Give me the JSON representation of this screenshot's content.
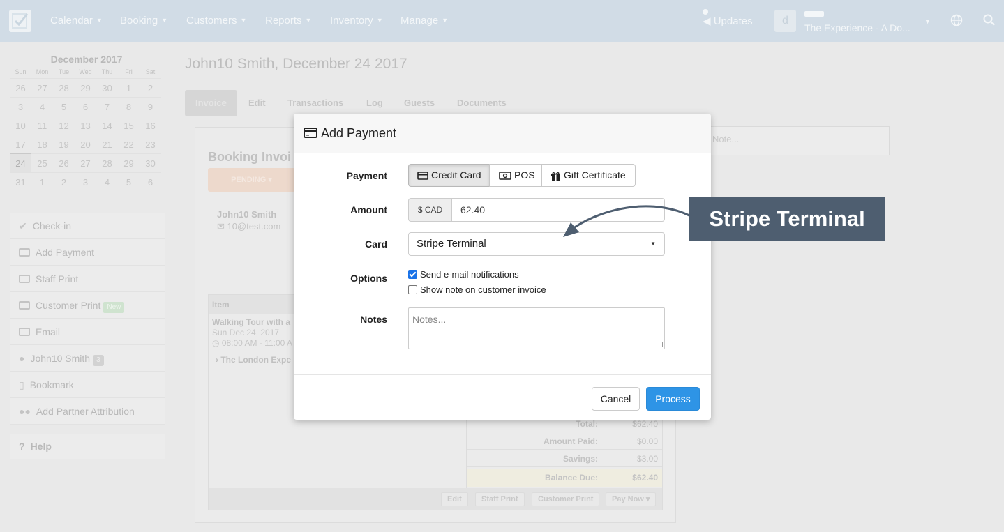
{
  "nav": {
    "items": [
      {
        "label": "Calendar"
      },
      {
        "label": "Booking"
      },
      {
        "label": "Customers"
      },
      {
        "label": "Reports"
      },
      {
        "label": "Inventory"
      },
      {
        "label": "Manage"
      }
    ],
    "updates_label": "Updates",
    "avatar_initial": "d",
    "account_name": "The Experience - A Do..."
  },
  "calendar": {
    "title": "December 2017",
    "dows": [
      "Sun",
      "Mon",
      "Tue",
      "Wed",
      "Thu",
      "Fri",
      "Sat"
    ],
    "days": [
      "26",
      "27",
      "28",
      "29",
      "30",
      "1",
      "2",
      "3",
      "4",
      "5",
      "6",
      "7",
      "8",
      "9",
      "10",
      "11",
      "12",
      "13",
      "14",
      "15",
      "16",
      "17",
      "18",
      "19",
      "20",
      "21",
      "22",
      "23",
      "24",
      "25",
      "26",
      "27",
      "28",
      "29",
      "30",
      "31",
      "1",
      "2",
      "3",
      "4",
      "5",
      "6"
    ],
    "selected": "24"
  },
  "sidebar": {
    "items": [
      {
        "label": "Check-in"
      },
      {
        "label": "Add Payment"
      },
      {
        "label": "Staff Print"
      },
      {
        "label": "Customer Print",
        "badge": "New"
      },
      {
        "label": "Email"
      },
      {
        "label": "John10 Smith",
        "badge": "3"
      },
      {
        "label": "Bookmark"
      },
      {
        "label": "Add Partner Attribution"
      }
    ],
    "help_label": "Help"
  },
  "page": {
    "title": "John10 Smith, December 24 2017",
    "tabs": [
      "Invoice",
      "Edit",
      "Transactions",
      "Log",
      "Guests",
      "Documents"
    ],
    "booking_title": "Booking Invoi",
    "status": "PENDING",
    "customer_name": "John10 Smith",
    "customer_email": "10@test.com",
    "note_placeholder": "Note...",
    "items_header": "Item",
    "item": {
      "name": "Walking Tour with a",
      "date": "Sun Dec 24, 2017",
      "time": "08:00 AM - 11:00 A",
      "vendor": "The London Expe"
    },
    "totals": [
      {
        "label": "Total:",
        "value": "$62.40"
      },
      {
        "label": "Amount Paid:",
        "value": "$0.00"
      },
      {
        "label": "Savings:",
        "value": "$3.00"
      }
    ],
    "balance_label": "Balance Due:",
    "balance_value": "$62.40",
    "footer_buttons": [
      "Edit",
      "Staff Print",
      "Customer Print",
      "Pay Now"
    ]
  },
  "modal": {
    "title": "Add Payment",
    "payment_label": "Payment",
    "payment_options": [
      "Credit Card",
      "POS",
      "Gift Certificate"
    ],
    "payment_selected": "Credit Card",
    "amount_label": "Amount",
    "currency_addon": "$ CAD",
    "amount_value": "62.40",
    "card_label": "Card",
    "card_selected": "Stripe Terminal",
    "options_label": "Options",
    "option_email": "Send e-mail notifications",
    "option_email_checked": true,
    "option_note": "Show note on customer invoice",
    "option_note_checked": false,
    "notes_label": "Notes",
    "notes_placeholder": "Notes...",
    "cancel_label": "Cancel",
    "process_label": "Process"
  },
  "callout": {
    "text": "Stripe Terminal"
  },
  "colors": {
    "primary_button": "#2e94e6",
    "callout_bg": "#4e5e70",
    "checkbox": "#1a73e8"
  }
}
